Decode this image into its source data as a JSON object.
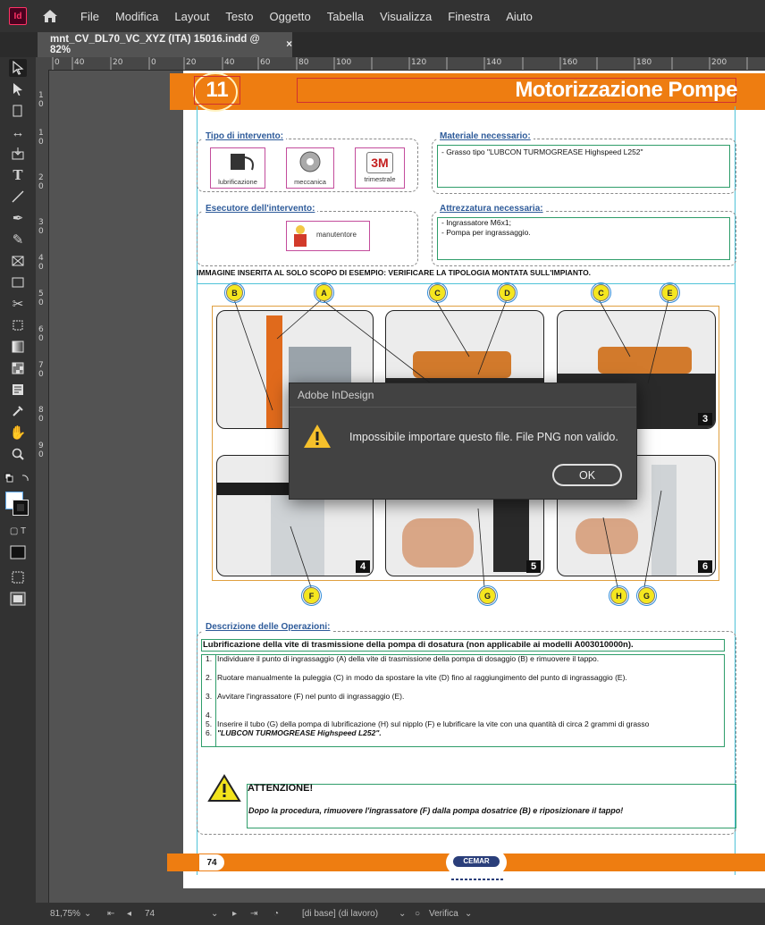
{
  "app": {
    "logo_text": "Id"
  },
  "menu": [
    "File",
    "Modifica",
    "Layout",
    "Testo",
    "Oggetto",
    "Tabella",
    "Visualizza",
    "Finestra",
    "Aiuto"
  ],
  "tab": {
    "title": "mnt_CV_DL70_VC_XYZ (ITA) 15016.indd @ 82%",
    "close": "×"
  },
  "ruler": {
    "top": [
      "0",
      "40",
      "20",
      "0",
      "20",
      "40",
      "60",
      "80",
      "100",
      "120",
      "140",
      "160",
      "180",
      "200"
    ],
    "left": [
      "1",
      "0",
      "1",
      "0",
      "2",
      "0",
      "3",
      "0",
      "4",
      "0",
      "5",
      "0",
      "6",
      "0",
      "7",
      "0",
      "8",
      "0",
      "9",
      "0"
    ]
  },
  "document": {
    "chapter_number": "11",
    "title": "Motorizzazione Pompe",
    "tipo_label": "Tipo di intervento:",
    "tipo_items": [
      "lubrificazione",
      "meccanica",
      "trimestrale"
    ],
    "materiale_label": "Materiale necessario:",
    "materiale_text": "- Grasso tipo \"LUBCON TURMOGREASE Highspeed L252\"",
    "esecutore_label": "Esecutore dell'intervento:",
    "esecutore_item": "manutentore",
    "attrezzatura_label": "Attrezzatura necessaria:",
    "attrezzatura_items": [
      "- Ingrassatore M6x1;",
      "- Pompa per ingrassaggio."
    ],
    "image_note": "IMMAGINE INSERITA AL SOLO SCOPO DI ESEMPIO: VERIFICARE LA TIPOLOGIA MONTATA SULL'IMPIANTO.",
    "callouts_top": [
      "B",
      "A",
      "C",
      "D",
      "C",
      "E"
    ],
    "callouts_bottom": [
      "F",
      "G",
      "H",
      "G"
    ],
    "photo_numbers": [
      "3",
      "4",
      "5",
      "6"
    ],
    "descr_label": "Descrizione delle Operazioni:",
    "descr_title": "Lubrificazione della vite di trasmissione della pompa di dosatura (non applicabile ai modelli A003010000n).",
    "steps": [
      {
        "num": "1.",
        "text": "Individuare il punto di ingrassaggio (A) della vite di trasmissione della pompa di dosaggio (B) e rimuovere il tappo."
      },
      {
        "num": "2.",
        "text": "Ruotare manualmente la puleggia (C) in modo da spostare la vite (D) fino al raggiungimento del punto di ingrassaggio (E)."
      },
      {
        "num": "3.",
        "text": "Avvitare l'ingrassatore (F) nel punto di ingrassaggio (E)."
      },
      {
        "num": "4.",
        "text": ""
      },
      {
        "num": "5.",
        "text": "Inserire il tubo (G) della pompa di lubrificazione (H) sul nipplo (F) e lubrificare la vite con una quantità di circa 2 grammi di grasso"
      },
      {
        "num": "6.",
        "text": "\"LUBCON TURMOGREASE Highspeed L252\"."
      }
    ],
    "warning_title": "ATTENZIONE!",
    "warning_text": "Dopo la procedura, rimuovere l'ingrassatore (F) dalla pompa dosatrice (B) e riposizionare il tappo!",
    "page_number": "74",
    "brand": "CEMAR"
  },
  "dialog": {
    "title": "Adobe InDesign",
    "message": "Impossibile importare questo file. File PNG non valido.",
    "ok": "OK"
  },
  "status": {
    "zoom": "81,75%",
    "page": "74",
    "master": "[di base] (di lavoro)",
    "preflight": "Verifica"
  },
  "colors": {
    "accent_orange": "#ee7d11",
    "callout_yellow": "#f5e61f",
    "dialog_bg": "#424242"
  }
}
